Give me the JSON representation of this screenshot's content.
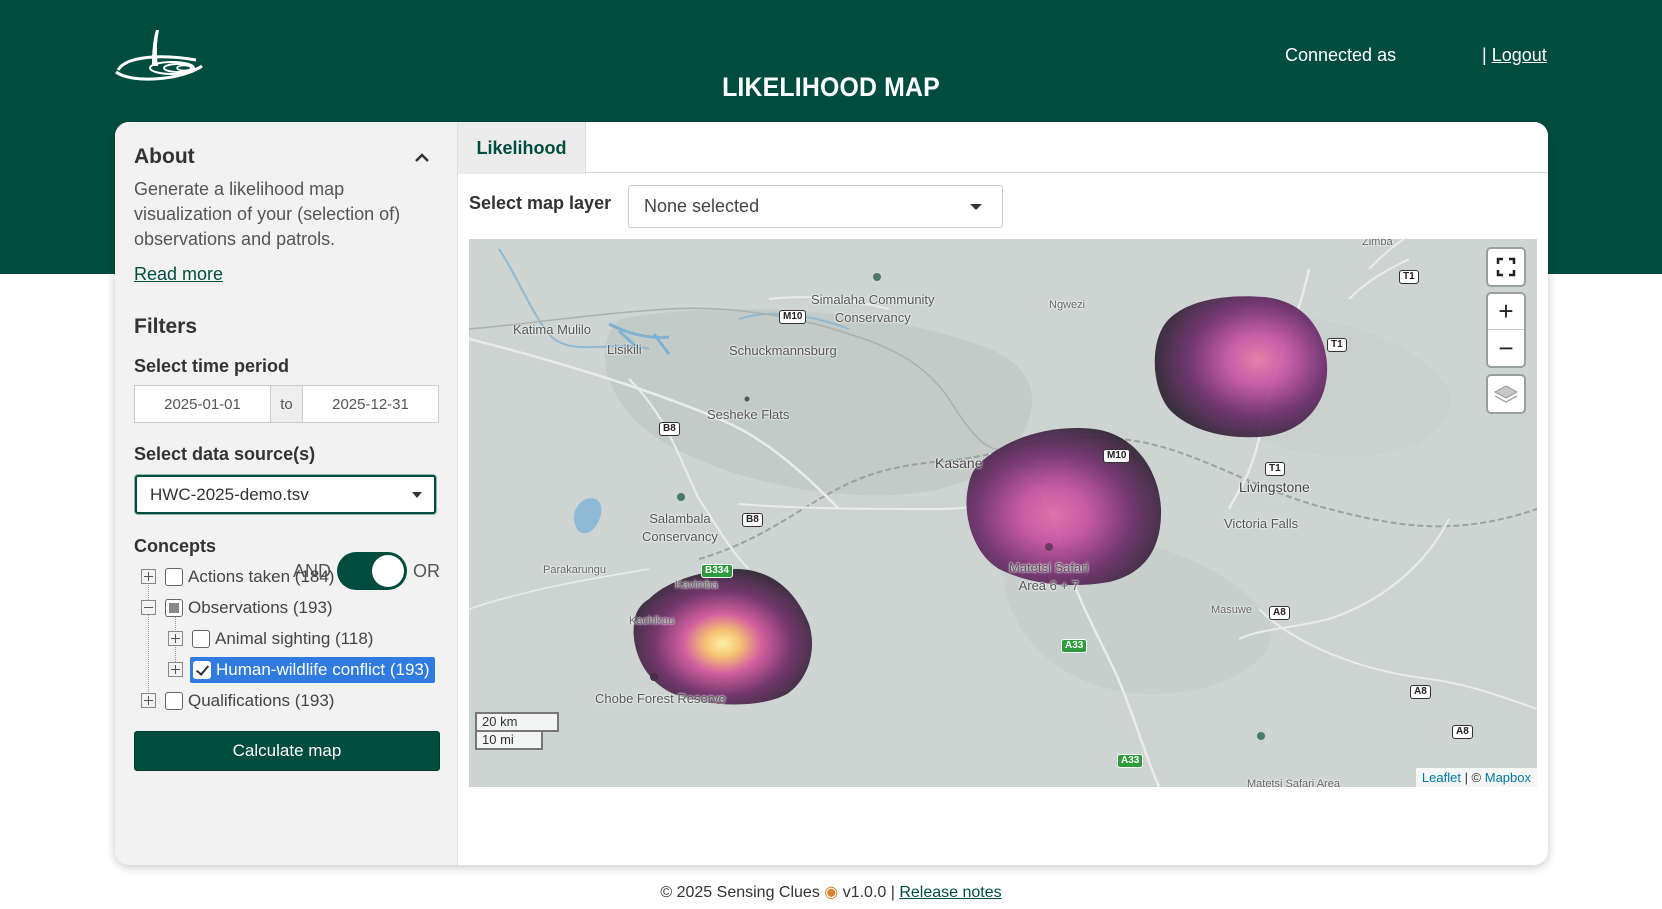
{
  "header": {
    "title": "LIKELIHOOD MAP",
    "connected_as": "Connected as",
    "separator": "|",
    "logout": "Logout"
  },
  "sidebar": {
    "about_title": "About",
    "about_text": "Generate a likelihood map visualization of your (selection of) observations and patrols.",
    "read_more": "Read more",
    "filters_title": "Filters",
    "time_period_label": "Select time period",
    "date_from": "2025-01-01",
    "date_to_sep": "to",
    "date_to": "2025-12-31",
    "data_source_label": "Select data source(s)",
    "data_source_value": "HWC-2025-demo.tsv",
    "concepts_label": "Concepts",
    "and_label": "AND",
    "or_label": "OR",
    "toggle_state": "OR",
    "tree": [
      {
        "label": "Actions taken (184)",
        "state": "unchecked",
        "level": 0
      },
      {
        "label": "Observations (193)",
        "state": "partial",
        "level": 0,
        "expanded": true
      },
      {
        "label": "Animal sighting (118)",
        "state": "unchecked",
        "level": 1
      },
      {
        "label": "Human-wildlife conflict (193)",
        "state": "checked",
        "level": 1,
        "selected": true
      },
      {
        "label": "Qualifications (193)",
        "state": "unchecked",
        "level": 0
      }
    ],
    "calculate_button": "Calculate map"
  },
  "main": {
    "tab_label": "Likelihood",
    "layer_label": "Select map layer",
    "layer_value": "None selected"
  },
  "map": {
    "labels": {
      "zimba": "Zimba",
      "ngwezi": "Ngwezi",
      "simalaha": "Simalaha Community\nConservancy",
      "katima": "Katima Mulilo",
      "lisikili": "Lisikili",
      "schuck": "Schuckmannsburg",
      "sesheke": "Sesheke Flats",
      "kasane": "Kasane",
      "livingstone": "Livingstone",
      "victoria": "Victoria Falls",
      "salambala": "Salambala\nConservancy",
      "parakarungu": "Parakarungu",
      "kavimba": "Kavimba",
      "kachikau": "Kachikau",
      "matetsi": "Matetsi Safari\nArea 6 + 7",
      "masuwe": "Masuwe",
      "chobe": "Chobe Forest Reserve",
      "matetsi2": "Matetsi Safari Area"
    },
    "shields": {
      "t1a": "T1",
      "t1b": "T1",
      "t1c": "T1",
      "m10a": "M10",
      "m10b": "M10",
      "b8a": "B8",
      "b8b": "B8",
      "b334": "B334",
      "a33a": "A33",
      "a33b": "A33",
      "a8a": "A8",
      "a8b": "A8",
      "a8c": "A8"
    },
    "scale_km": "20 km",
    "scale_mi": "10 mi",
    "attrib_leaflet": "Leaflet",
    "attrib_sep": " | © ",
    "attrib_mapbox": "Mapbox",
    "zoom_in": "+",
    "zoom_out": "−"
  },
  "footer": {
    "copyright": "© 2025 Sensing Clues",
    "version": " v1.0.0 | ",
    "release_notes": "Release notes"
  },
  "colors": {
    "brand": "#004d40",
    "selection": "#2f7be0",
    "heat_low": "#3b1f3f",
    "heat_mid": "#c34fa0",
    "heat_high": "#fcef9a"
  }
}
